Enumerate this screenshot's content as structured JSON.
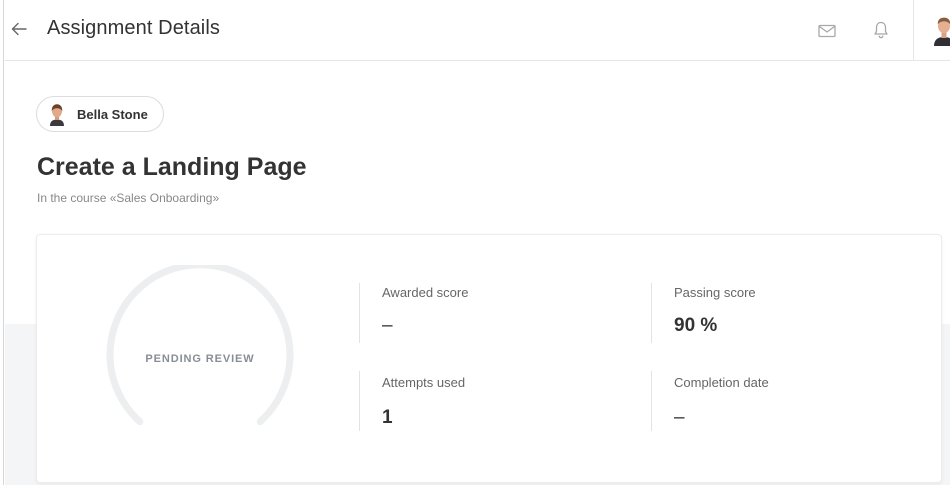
{
  "header": {
    "title": "Assignment Details",
    "back_icon": "arrow-left-icon",
    "mail_icon": "mail-icon",
    "notifications_icon": "bell-icon"
  },
  "student": {
    "name": "Bella Stone"
  },
  "assignment": {
    "title": "Create a Landing Page",
    "course_line": "In the course «Sales Onboarding»"
  },
  "status": {
    "label": "PENDING REVIEW"
  },
  "stats": {
    "awarded_score": {
      "label": "Awarded score",
      "value": "–"
    },
    "passing_score": {
      "label": "Passing score",
      "value": "90 %"
    },
    "attempts_used": {
      "label": "Attempts used",
      "value": "1"
    },
    "completion_date": {
      "label": "Completion date",
      "value": "–"
    }
  },
  "colors": {
    "text_primary": "#333333",
    "text_muted": "#888888",
    "gauge_track": "#eceef0",
    "page_background": "#f4f5f7"
  }
}
